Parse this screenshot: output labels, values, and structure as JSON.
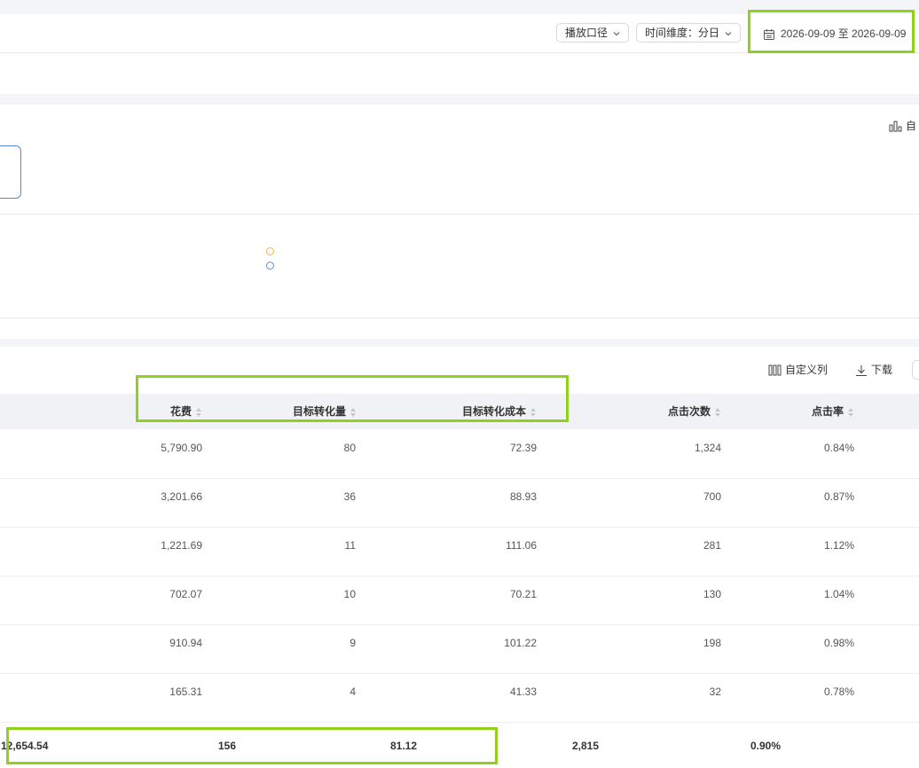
{
  "filters": {
    "play_scope": "播放口径",
    "time_dim": "时间维度：分日",
    "date_range": "2026-09-09 至 2026-09-09"
  },
  "chart_toolbar_label": "自",
  "table_toolbar": {
    "custom_columns": "自定义列",
    "download": "下载"
  },
  "columns": {
    "spend": "花费",
    "target_conversions": "目标转化量",
    "target_cost": "目标转化成本",
    "clicks": "点击次数",
    "ctr": "点击率"
  },
  "rows": [
    {
      "spend": "5,790.90",
      "conv": "80",
      "cost": "72.39",
      "clicks": "1,324",
      "ctr": "0.84%"
    },
    {
      "spend": "3,201.66",
      "conv": "36",
      "cost": "88.93",
      "clicks": "700",
      "ctr": "0.87%"
    },
    {
      "spend": "1,221.69",
      "conv": "11",
      "cost": "111.06",
      "clicks": "281",
      "ctr": "1.12%"
    },
    {
      "spend": "702.07",
      "conv": "10",
      "cost": "70.21",
      "clicks": "130",
      "ctr": "1.04%"
    },
    {
      "spend": "910.94",
      "conv": "9",
      "cost": "101.22",
      "clicks": "198",
      "ctr": "0.98%"
    },
    {
      "spend": "165.31",
      "conv": "4",
      "cost": "41.33",
      "clicks": "32",
      "ctr": "0.78%"
    }
  ],
  "totals": {
    "spend": "12,654.54",
    "conv": "156",
    "cost": "81.12",
    "clicks": "2,815",
    "ctr": "0.90%"
  },
  "legend_colors": [
    "#f0b34a",
    "#5b8fe0"
  ],
  "highlight_color": "#8fd11c"
}
